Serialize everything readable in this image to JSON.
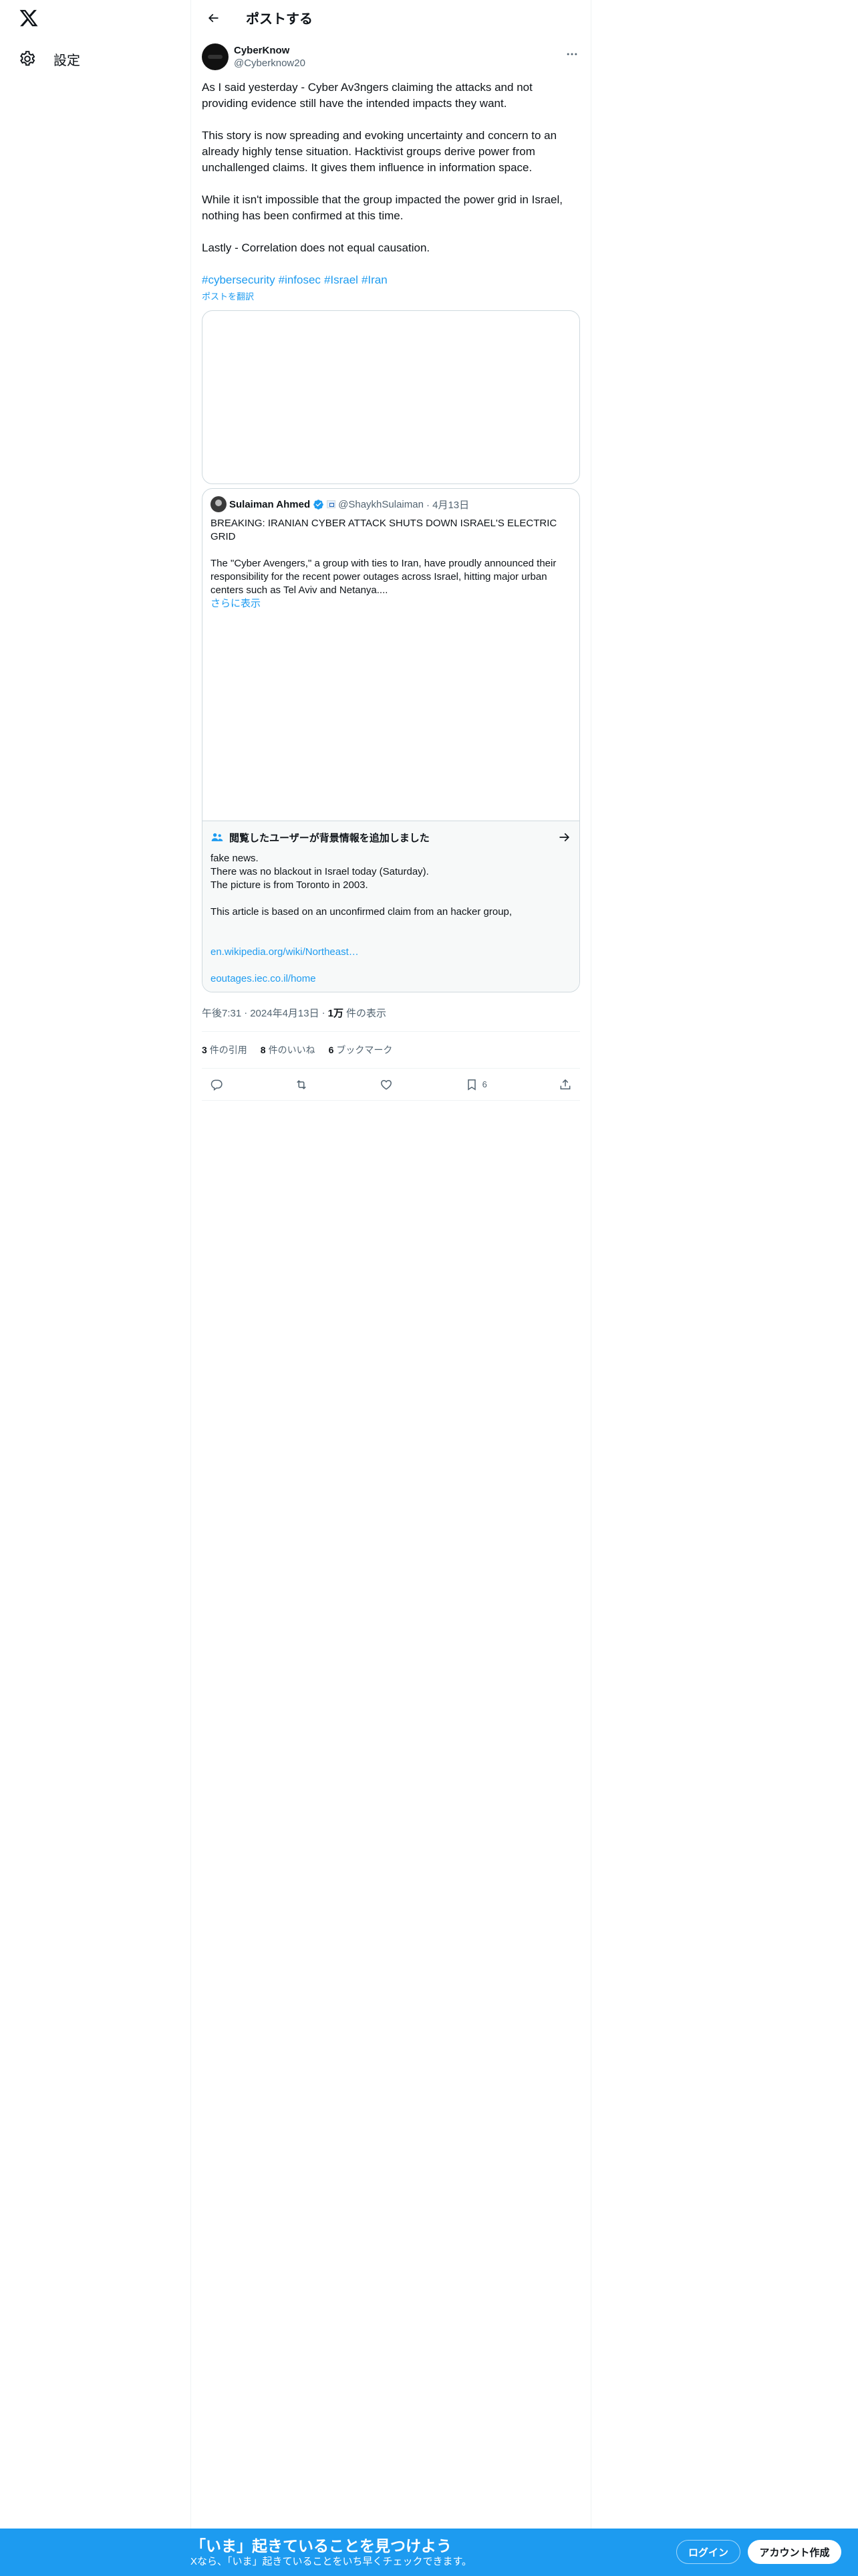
{
  "nav": {
    "settings_label": "設定"
  },
  "header": {
    "title": "ポストする"
  },
  "post": {
    "author_name": "CyberKnow",
    "author_handle": "@Cyberknow20",
    "paragraphs": [
      "As I said yesterday - Cyber Av3ngers claiming the attacks and not providing evidence still have the intended impacts they want.",
      "This story is now spreading and evoking uncertainty and concern to an already highly tense situation. Hacktivist groups derive power from unchallenged claims. It gives them influence in information space.",
      "While it isn't impossible that the group impacted the power grid in Israel, nothing has been confirmed at this time.",
      "Lastly - Correlation does not equal causation."
    ],
    "hashtags": [
      "#cybersecurity",
      "#infosec",
      "#Israel",
      "#Iran"
    ],
    "translate_label": "ポストを翻訳"
  },
  "quote": {
    "name": "Sulaiman Ahmed",
    "handle": "@ShaykhSulaiman",
    "date": "· 4月13日",
    "headline": "BREAKING: IRANIAN CYBER ATTACK SHUTS DOWN ISRAEL'S ELECTRIC GRID",
    "text": "The \"Cyber Avengers,\" a group with ties to Iran, have proudly announced their responsibility for the recent power outages across Israel, hitting major urban centers such as Tel Aviv and Netanya....",
    "show_more": "さらに表示"
  },
  "context": {
    "title": "閲覧したユーザーが背景情報を追加しました",
    "line1": "fake news.",
    "line2": "There was no blackout in Israel today (Saturday).",
    "line3": "The picture is from Toronto in 2003.",
    "line4": "This article is based on an unconfirmed claim from an hacker group,",
    "link1": "en.wikipedia.org/wiki/Northeast…",
    "link2": "eoutages.iec.co.il/home"
  },
  "meta": {
    "time": "午後7:31",
    "sep1": "·",
    "date": "2024年4月13日",
    "sep2": "·",
    "views_count": "1万",
    "views_label": "件の表示"
  },
  "stats": {
    "quotes_count": "3",
    "quotes_label": "件の引用",
    "likes_count": "8",
    "likes_label": "件のいいね",
    "bookmarks_count": "6",
    "bookmarks_label": "ブックマーク"
  },
  "actions": {
    "bookmark_count": "6"
  },
  "banner": {
    "title": "「いま」起きていることを見つけよう",
    "subtitle": "Xなら、「いま」起きていることをいち早くチェックできます。",
    "login_label": "ログイン",
    "signup_label": "アカウント作成"
  }
}
